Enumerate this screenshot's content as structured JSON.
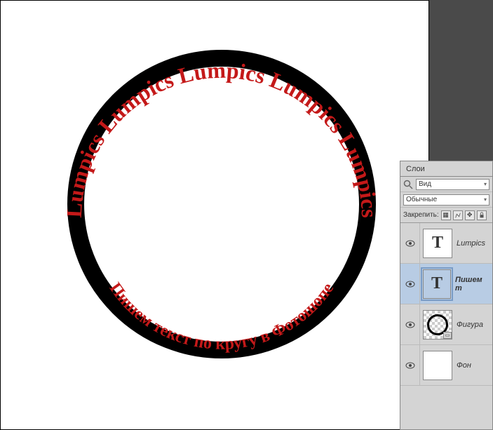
{
  "canvas": {
    "upper_curved_text": "Lumpics Lumpics Lumpics Lumpics Lumpics",
    "lower_curved_text": "Пишем текст по кругу в Фотошопе"
  },
  "layers_panel": {
    "tab_label": "Слои",
    "search_label": "Вид",
    "blend_mode": "Обычные",
    "lock_label": "Закрепить:",
    "layers": [
      {
        "name": "Lumpics",
        "type": "text",
        "visible": true,
        "selected": false
      },
      {
        "name": "Пишем т",
        "type": "text",
        "visible": true,
        "selected": true
      },
      {
        "name": "Фигура",
        "type": "shape",
        "visible": true,
        "selected": false
      },
      {
        "name": "Фон",
        "type": "background",
        "visible": true,
        "selected": false
      }
    ]
  }
}
